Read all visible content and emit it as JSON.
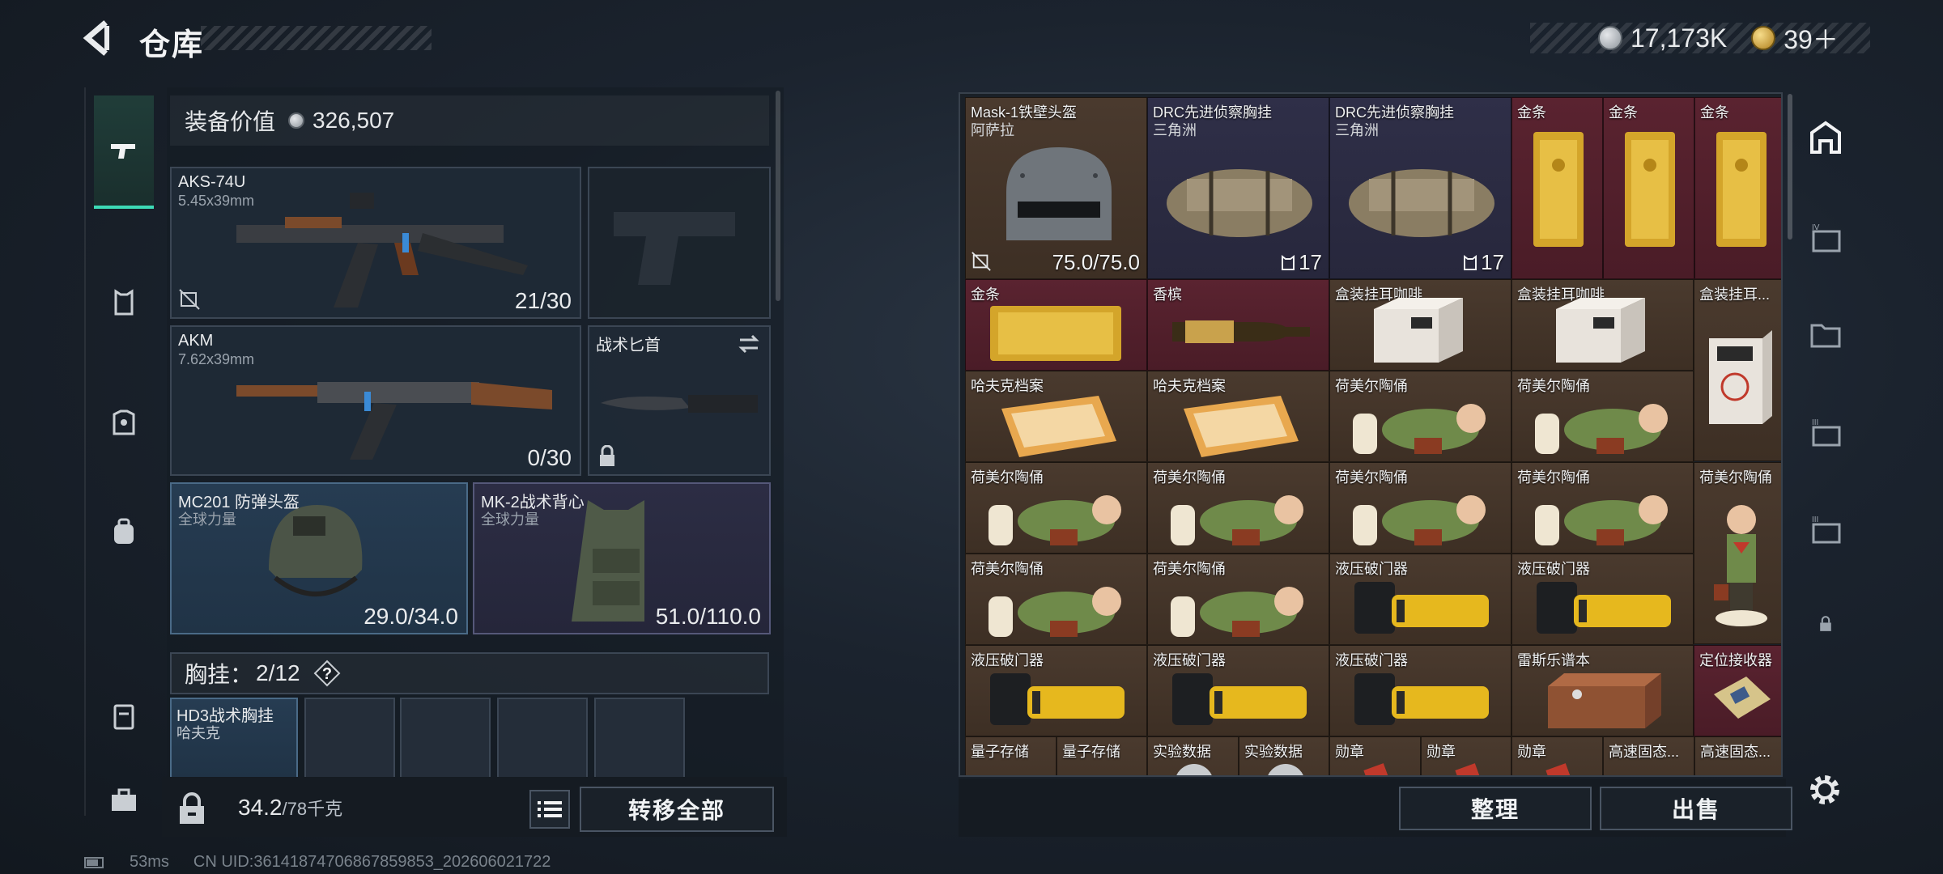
{
  "header": {
    "title": "仓库",
    "balance": "17,173K",
    "gold": "39＋"
  },
  "left": {
    "equip_value_label": "装备价值",
    "equip_value": "326,507",
    "weapon1": {
      "name": "AKS-74U",
      "caliber": "5.45x39mm",
      "ammo": "21/30"
    },
    "weapon2": {
      "name": "AKM",
      "caliber": "7.62x39mm",
      "ammo": "0/30"
    },
    "melee": {
      "name": "战术匕首"
    },
    "helmet": {
      "name": "MC201 防弹头盔",
      "origin": "全球力量",
      "durability": "29.0/34.0"
    },
    "armor": {
      "name": "MK-2战术背心",
      "origin": "全球力量",
      "durability": "51.0/110.0"
    },
    "vest": {
      "label": "胸挂：",
      "count": "2/12",
      "help": "?"
    },
    "vest_item": {
      "name": "HD3战术胸挂",
      "origin": "哈夫克"
    },
    "weight": "34.2",
    "weight_max": "/78千克",
    "transfer_all": "转移全部"
  },
  "stash": {
    "row1": [
      {
        "name": "Mask-1铁壁头盔",
        "origin": "阿萨拉",
        "stat": "75.0/75.0"
      },
      {
        "name": "DRC先进侦察胸挂",
        "origin": "三角洲",
        "stat": "17"
      },
      {
        "name": "DRC先进侦察胸挂",
        "origin": "三角洲",
        "stat": "17"
      },
      {
        "name": "金条"
      },
      {
        "name": "金条"
      },
      {
        "name": "金条"
      }
    ],
    "row2": [
      {
        "name": "金条"
      },
      {
        "name": "香槟"
      },
      {
        "name": "盒装挂耳咖啡"
      },
      {
        "name": "盒装挂耳咖啡"
      },
      {
        "name": "盒装挂耳..."
      }
    ],
    "row3": [
      {
        "name": "哈夫克档案"
      },
      {
        "name": "哈夫克档案"
      },
      {
        "name": "荷美尔陶俑"
      },
      {
        "name": "荷美尔陶俑"
      }
    ],
    "row4": [
      {
        "name": "荷美尔陶俑"
      },
      {
        "name": "荷美尔陶俑"
      },
      {
        "name": "荷美尔陶俑"
      },
      {
        "name": "荷美尔陶俑"
      },
      {
        "name": "荷美尔陶俑"
      }
    ],
    "row5": [
      {
        "name": "荷美尔陶俑"
      },
      {
        "name": "荷美尔陶俑"
      },
      {
        "name": "液压破门器"
      },
      {
        "name": "液压破门器"
      }
    ],
    "row6": [
      {
        "name": "液压破门器"
      },
      {
        "name": "液压破门器"
      },
      {
        "name": "液压破门器"
      },
      {
        "name": "雷斯乐谱本"
      },
      {
        "name": "定位接收器"
      }
    ],
    "row7": [
      {
        "name": "量子存储"
      },
      {
        "name": "量子存储"
      },
      {
        "name": "实验数据"
      },
      {
        "name": "实验数据"
      },
      {
        "name": "勋章"
      },
      {
        "name": "勋章"
      },
      {
        "name": "勋章"
      },
      {
        "name": "高速固态..."
      },
      {
        "name": "高速固态..."
      }
    ],
    "sort_label": "整理",
    "sell_label": "出售"
  },
  "status": {
    "ping": "53ms",
    "uid": "CN UID:36141874706867859853_202606021722"
  }
}
